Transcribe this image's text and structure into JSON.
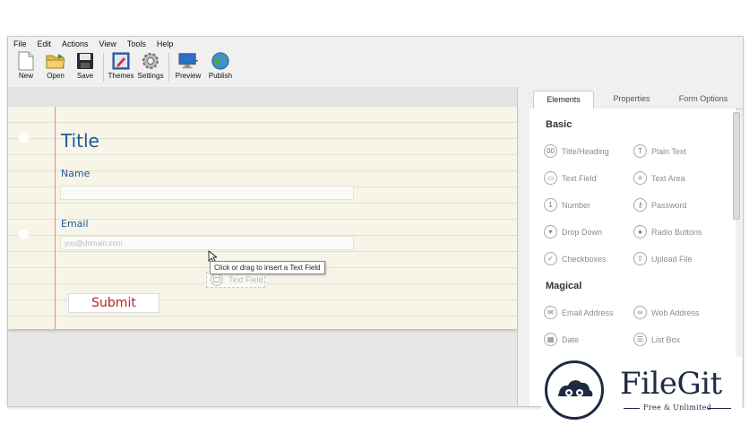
{
  "menu": [
    "File",
    "Edit",
    "Actions",
    "View",
    "Tools",
    "Help"
  ],
  "toolbar": {
    "new_label": "New",
    "open_label": "Open",
    "save_label": "Save",
    "themes_label": "Themes",
    "settings_label": "Settings",
    "preview_label": "Preview",
    "publish_label": "Publish"
  },
  "form": {
    "title": "Title",
    "name_label": "Name",
    "name_value": "",
    "email_label": "Email",
    "email_placeholder": "you@domain.com",
    "submit_label": "Submit"
  },
  "drag": {
    "ghost_label": "Text Field",
    "tooltip": "Click or drag to insert a Text Field"
  },
  "panel": {
    "tabs": [
      "Elements",
      "Properties",
      "Form Options"
    ],
    "active_tab": "Elements",
    "sections": {
      "basic": "Basic",
      "magical": "Magical"
    },
    "basic_items": [
      "Title/Heading",
      "Plain Text",
      "Text Field",
      "Text Area",
      "Number",
      "Password",
      "Drop Down",
      "Radio Buttons",
      "Checkboxes",
      "Upload File"
    ],
    "magical_items": [
      "Email Address",
      "Web Address",
      "Date",
      "List Box"
    ]
  },
  "watermark": {
    "brand": "FileGit",
    "tagline": "Free & Unlimited"
  }
}
